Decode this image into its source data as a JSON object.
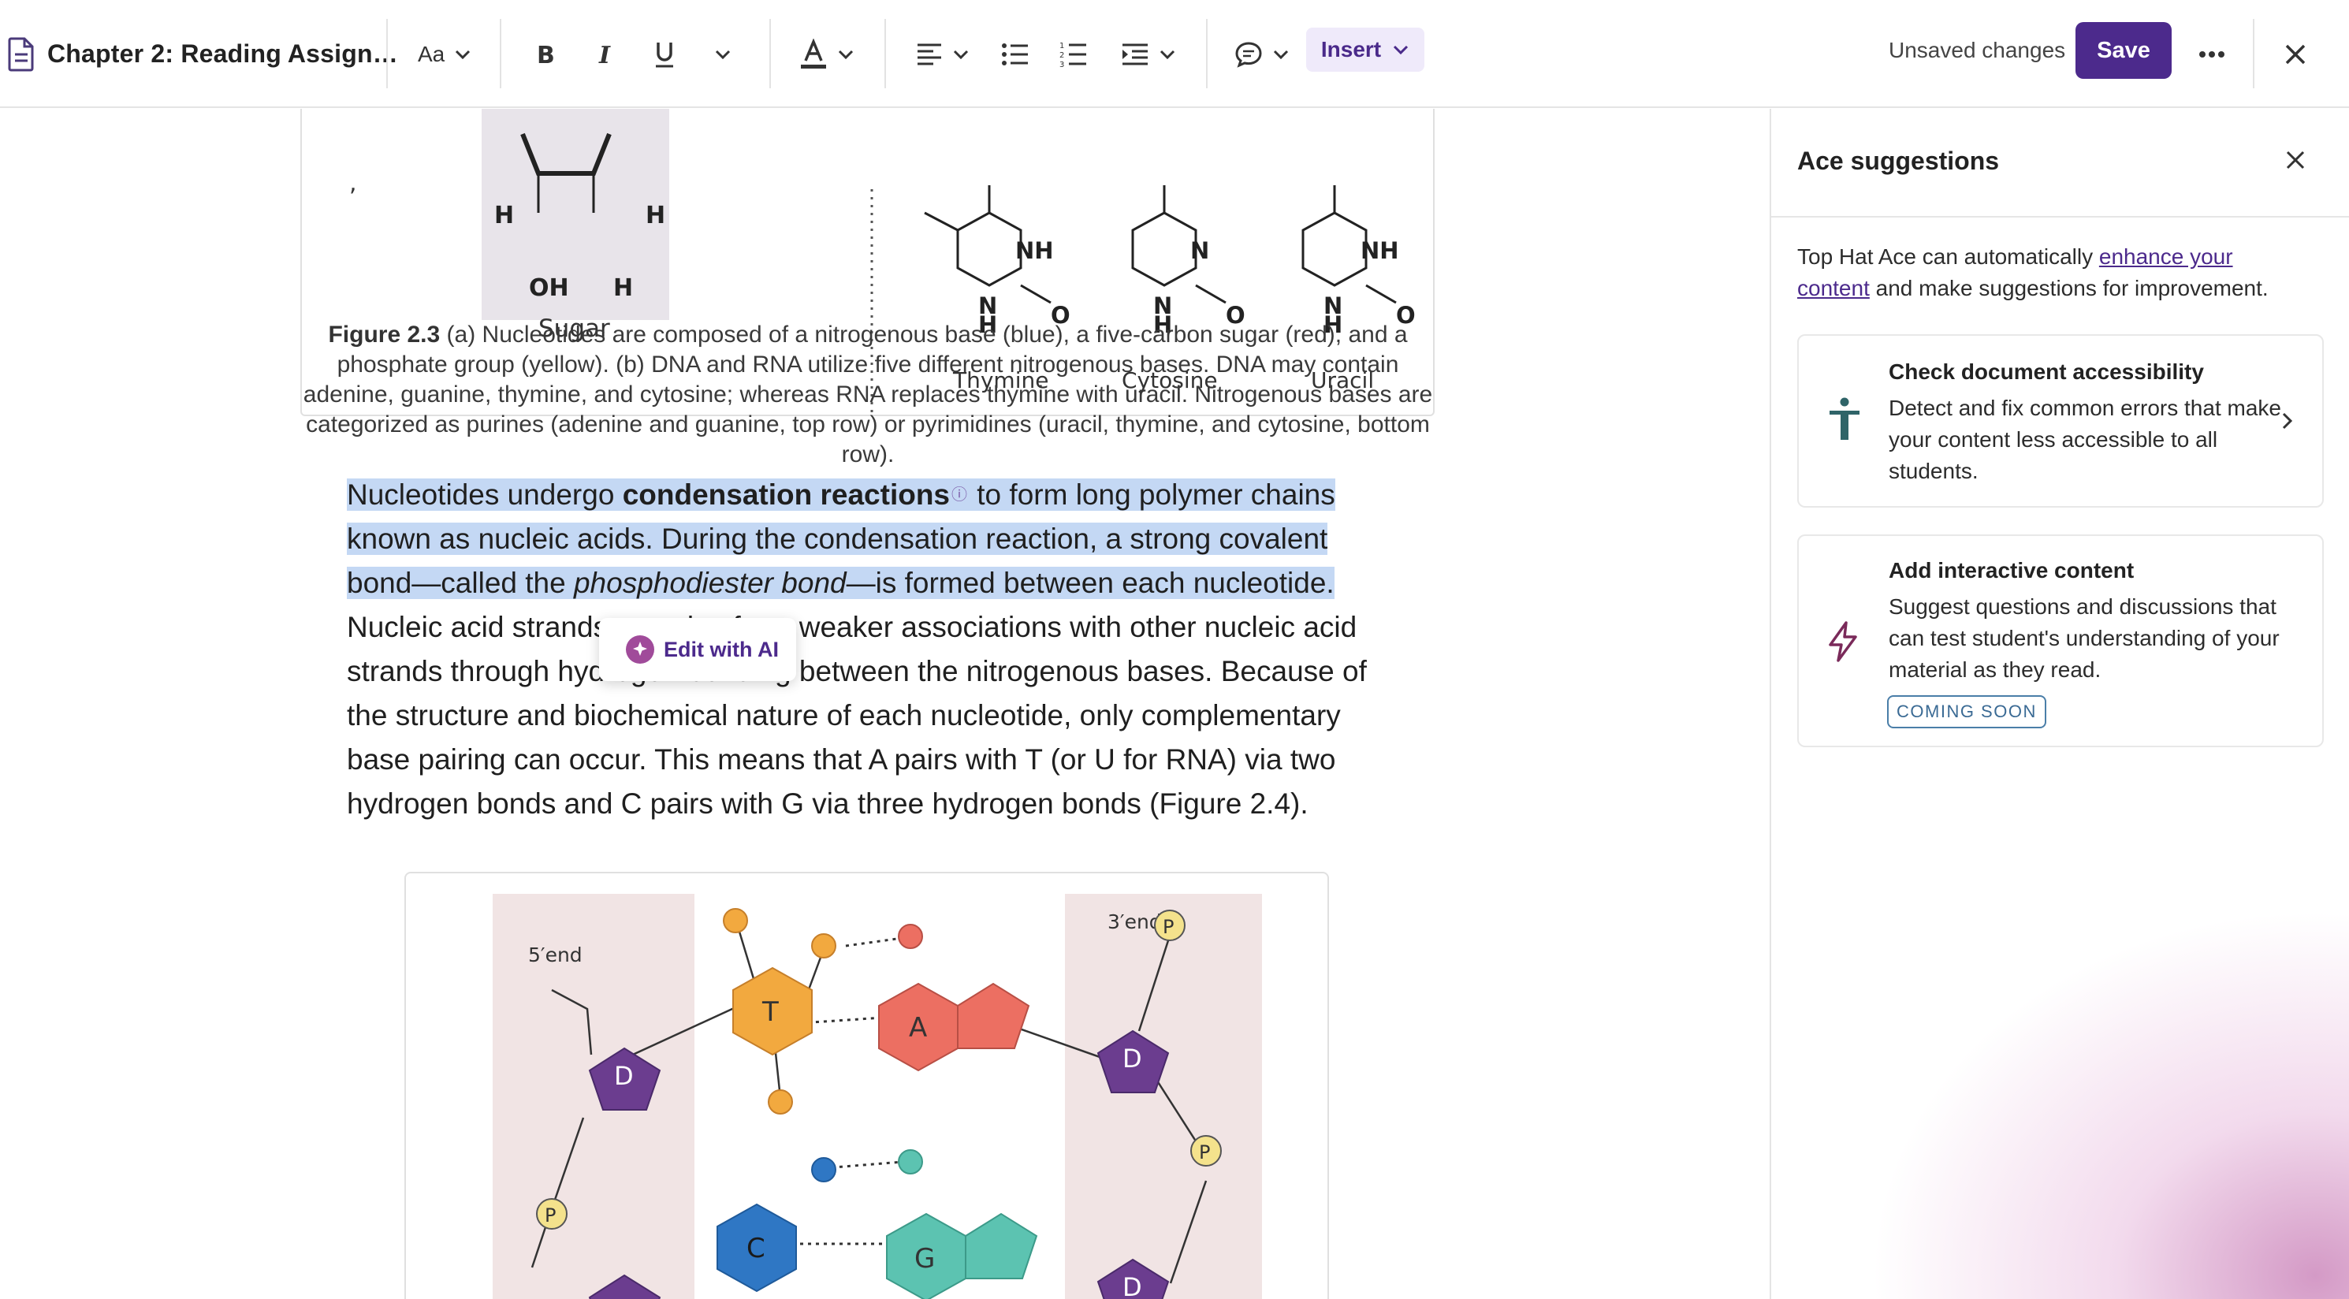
{
  "toolbar": {
    "doc_title": "Chapter 2: Reading Assign…",
    "font_size_label": "Aa",
    "insert_label": "Insert",
    "unsaved_label": "Unsaved changes",
    "save_label": "Save"
  },
  "figure_top": {
    "labels": {
      "oh": "OH",
      "h": "H",
      "sugar": "Sugar",
      "thymine": "Thymine",
      "cytosine": "Cytosine",
      "uracil": "Uracil",
      "nh": "NH",
      "n": "N",
      "o": "O"
    }
  },
  "caption": {
    "label": "Figure 2.3",
    "text": " (a) Nucleotides are composed of a nitrogenous base (blue), a five-carbon sugar (red), and a phosphate group (yellow). (b) DNA and RNA utilize five different nitrogenous bases. DNA may contain adenine, guanine, thymine, and cytosine; whereas RNA replaces thymine with uracil. Nitrogenous bases are categorized as purines (adenine and guanine, top row) or pyrimidines (uracil, thymine, and cytosine, bottom row)."
  },
  "paragraph": {
    "p1": "Nucleotides undergo ",
    "term": "condensation reactions",
    "info_icon": "ⓘ",
    "p2": " to form long polymer chains known as nucleic acids. During the condensation reaction, a strong covalent bond—called the ",
    "italic": "phosphodiester bond",
    "p3": "—is formed between each nucleotide.",
    "p4": " Nucleic acid strands can also form weaker associations with other nucleic acid strands through hydrogen bonding between the nitrogenous bases. Because of the structure and biochemical nature of each nucleotide, only complementary base pairing can occur. This means that A pairs with T (or U for RNA) via two hydrogen bonds and C pairs with G via three hydrogen bonds (Figure 2.4)."
  },
  "ai_popup": {
    "label": "Edit with AI"
  },
  "figure_bottom": {
    "five_end": "5′end",
    "three_end": "3′end",
    "p": "P",
    "d": "D",
    "t": "T",
    "a": "A",
    "c": "C",
    "g": "G"
  },
  "panel": {
    "title": "Ace suggestions",
    "intro_before": "Top Hat Ace can automatically ",
    "intro_link": "enhance your content",
    "intro_after": " and make suggestions for improvement.",
    "cards": [
      {
        "title": "Check document accessibility",
        "desc": "Detect and fix common errors that make your content less accessible to all students."
      },
      {
        "title": "Add interactive content",
        "desc": "Suggest questions and discussions that can test student's understanding of your material as they read.",
        "badge": "COMING SOON"
      }
    ]
  },
  "colors": {
    "accent": "#4c2a8c",
    "highlight": "#c4d8f4",
    "thymine_orange": "#f2a93f",
    "adenine_red": "#ec6f62",
    "cytosine_blue": "#2f77c4",
    "guanine_teal": "#5cc3b1",
    "deoxyribose_purple": "#6b3d8f",
    "phosphate_yellow": "#f4e28c"
  }
}
